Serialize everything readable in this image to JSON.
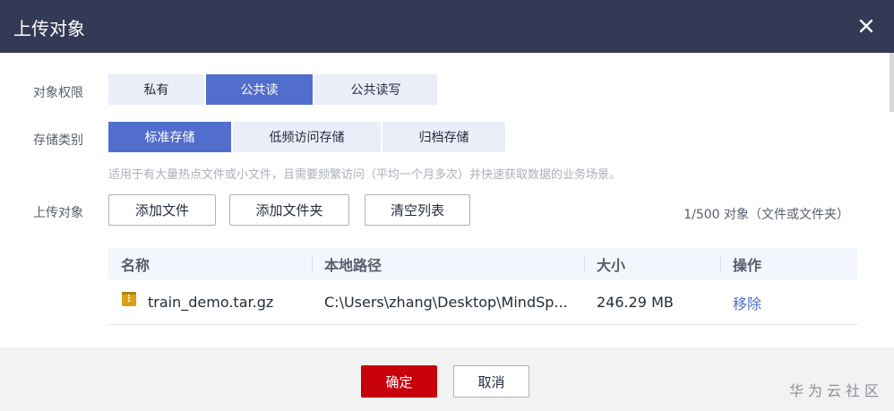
{
  "dialog": {
    "title": "上传对象",
    "close_icon": "close-icon"
  },
  "acl": {
    "label": "对象权限",
    "options": [
      "私有",
      "公共读",
      "公共读写"
    ],
    "selected": "公共读"
  },
  "storage_class": {
    "label": "存储类别",
    "options": [
      "标准存储",
      "低频访问存储",
      "归档存储"
    ],
    "selected": "标准存储",
    "hint": "适用于有大量热点文件或小文件，且需要频繁访问（平均一个月多次）并快速获取数据的业务场景。"
  },
  "upload": {
    "label": "上传对象",
    "add_file": "添加文件",
    "add_folder": "添加文件夹",
    "clear_list": "清空列表",
    "count": "1/500 对象（文件或文件夹）"
  },
  "table": {
    "headers": [
      "名称",
      "本地路径",
      "大小",
      "操作"
    ],
    "rows": [
      {
        "name": "train_demo.tar.gz",
        "path": "C:\\Users\\zhang\\Desktop\\MindSp...",
        "size": "246.29 MB",
        "action": "移除",
        "icon": "archive-file-icon"
      }
    ]
  },
  "footer": {
    "ok": "确定",
    "cancel": "取消",
    "watermark": "华为云社区"
  },
  "colors": {
    "header_bg": "#343a56",
    "accent": "#526ecc",
    "ok_button": "#c7000b",
    "segment_bg": "#e9eef9"
  }
}
